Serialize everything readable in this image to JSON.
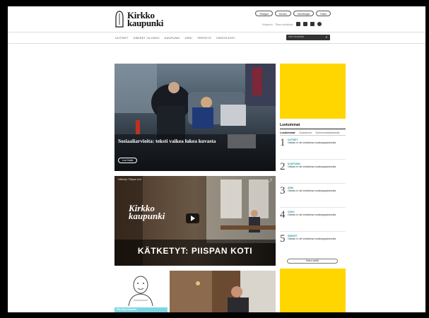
{
  "header": {
    "logo_line1": "Kirkko",
    "logo_line2": "kaupunki",
    "pills": [
      "Tilaajat",
      "Kirkko",
      "Ilmoittajat",
      "Haku"
    ],
    "small_link": "Kirjaudu · Tilaa uutiskirje",
    "social": [
      "facebook-icon",
      "twitter-icon",
      "instagram-icon",
      "rss-icon"
    ]
  },
  "nav": {
    "items": [
      "UUTISET",
      "IHMISET JA USKO",
      "KAUPUNKI",
      "ARKI",
      "TERVEYS",
      "VIIKKOLEHTI",
      "KIRKKO ARKISTO",
      "RSS"
    ],
    "search_placeholder": "Hae sivustolta"
  },
  "hero": {
    "title": "Sosiaaliarvioita: teksti vaikea lukea kuvasta",
    "button": "Lue lisää"
  },
  "widget": {
    "title": "Luetuimmat",
    "tabs": [
      "Luetuimmat",
      "Uusimmat",
      "Kommentoiduimmat"
    ],
    "items": [
      {
        "num": "1",
        "cat": "UUTISET",
        "text": "Otsikko ei ole luettavissa kuvakaappauksesta"
      },
      {
        "num": "2",
        "cat": "KAUPUNKI",
        "text": "Otsikko ei ole luettavissa kuvakaappauksesta"
      },
      {
        "num": "3",
        "cat": "ARKI",
        "text": "Otsikko ei ole luettavissa kuvakaappauksesta"
      },
      {
        "num": "4",
        "cat": "USKO",
        "text": "Otsikko ei ole luettavissa kuvakaappauksesta"
      },
      {
        "num": "5",
        "cat": "IHMISET",
        "text": "Otsikko ei ole luettavissa kuvakaappauksesta"
      }
    ],
    "more": "Katso kaikki"
  },
  "video": {
    "logo_line1": "Kirkko",
    "logo_line2": "kaupunki",
    "top_text": "Kätketyt: Piispan koti",
    "title": "KÄTKETYT: PIISPAN KOTI"
  },
  "bottom": {
    "card_label": "Piirretty ihminen"
  },
  "colors": {
    "accent_yellow": "#ffd600",
    "accent_teal": "#2aa2a8",
    "label_cyan": "#7ed6e3"
  }
}
